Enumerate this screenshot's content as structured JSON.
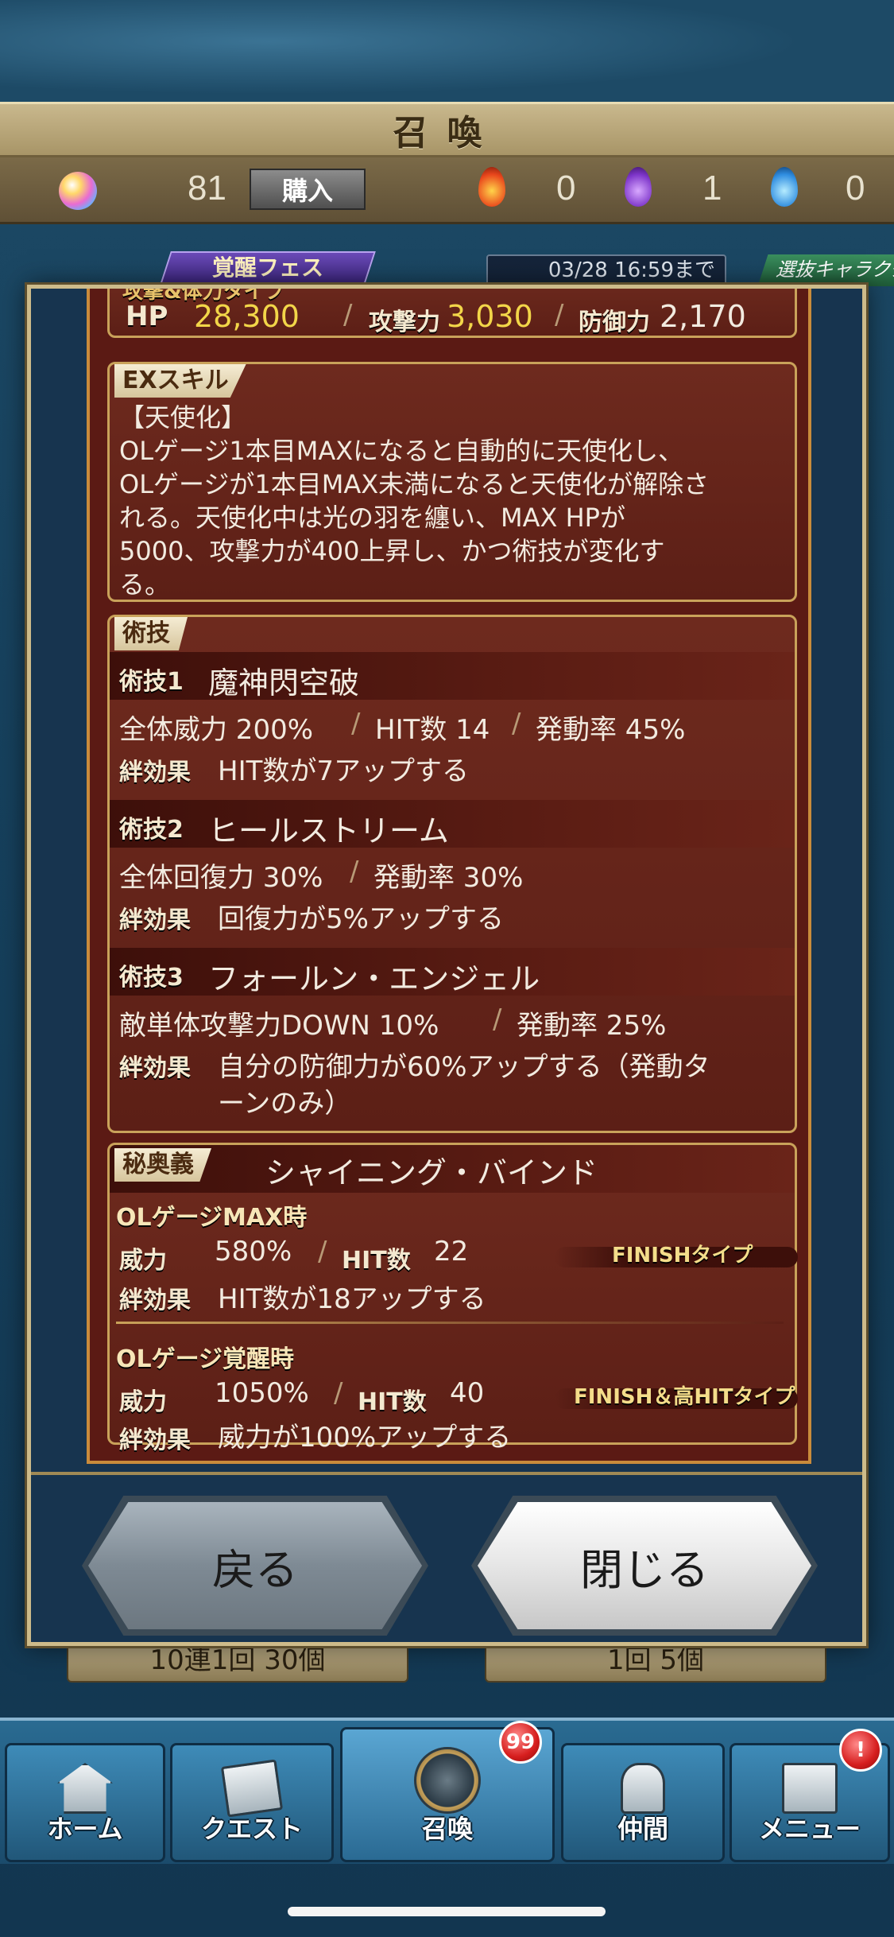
{
  "header": {
    "title": "召喚",
    "gems": "81",
    "buy_label": "購入",
    "fire_count": "0",
    "purple_count": "1",
    "blue_count": "0"
  },
  "banner": {
    "fes_label": "覚醒フェス",
    "end_date": "03/28 16:59まで",
    "select_label": "選抜キャラクタ"
  },
  "stats": {
    "type_label": "攻撃&体力タイプ",
    "hp_label": "HP",
    "hp_value": "28,300",
    "atk_label": "攻撃力",
    "atk_value": "3,030",
    "def_label": "防御力",
    "def_value": "2,170",
    "sep": "/"
  },
  "ex_skill": {
    "tag": "EXスキル",
    "lines": [
      "【天使化】",
      "OLゲージ1本目MAXになると自動的に天使化し、",
      "OLゲージが1本目MAX未満になると天使化が解除さ",
      "れる。天使化中は光の羽を纏い、MAX HPが",
      "5000、攻撃力が400上昇し、かつ術技が変化す",
      "る。"
    ]
  },
  "arts": {
    "tag": "術技",
    "bond_label": "絆効果",
    "items": [
      {
        "label": "術技1",
        "name": "魔神閃空破",
        "stats": [
          "全体威力 200%",
          "HIT数 14",
          "発動率 45%"
        ],
        "bond": "HIT数が7アップする"
      },
      {
        "label": "術技2",
        "name": "ヒールストリーム",
        "stats": [
          "全体回復力 30%",
          "発動率 30%"
        ],
        "bond": "回復力が5%アップする"
      },
      {
        "label": "術技3",
        "name": "フォールン・エンジェル",
        "stats": [
          "敵単体攻撃力DOWN 10%",
          "発動率 25%"
        ],
        "bond": "自分の防御力が60%アップする（発動タ",
        "bond2": "ーンのみ）"
      }
    ]
  },
  "mystic": {
    "tag": "秘奥義",
    "name": "シャイニング・バインド",
    "max": {
      "title": "OLゲージMAX時",
      "power_label": "威力",
      "power": "580%",
      "hit_label": "HIT数",
      "hit": "22",
      "type": "FINISHタイプ",
      "bond": "HIT数が18アップする"
    },
    "awake": {
      "title": "OLゲージ覚醒時",
      "power_label": "威力",
      "power": "1050%",
      "hit_label": "HIT数",
      "hit": "40",
      "type": "FINISH＆高HITタイプ",
      "bond": "威力が100%アップする"
    }
  },
  "buttons": {
    "back": "戻る",
    "close": "閉じる"
  },
  "summon_options": {
    "ten": "10連1回 30個",
    "one": "1回 5個"
  },
  "nav": {
    "home": "ホーム",
    "quest": "クエスト",
    "summon": "召喚",
    "summon_badge": "99",
    "friend": "仲間",
    "menu": "メニュー",
    "menu_badge": "!"
  }
}
